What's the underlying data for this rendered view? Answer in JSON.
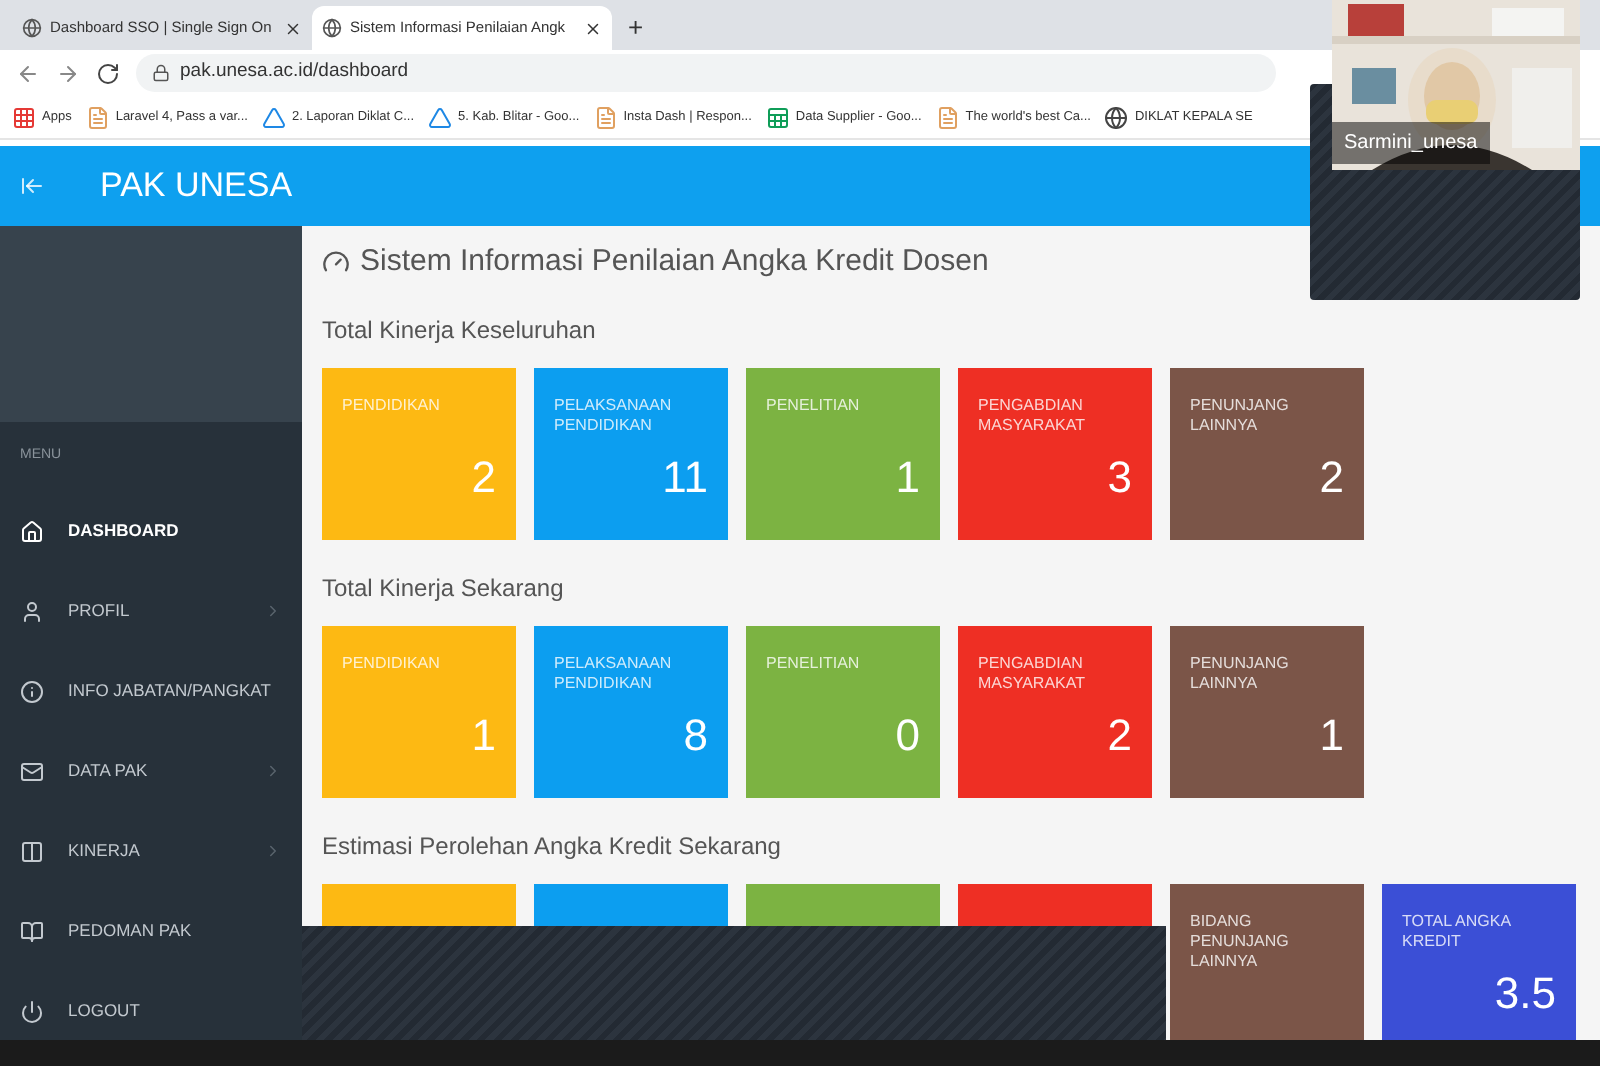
{
  "browser": {
    "tabs": [
      {
        "title": "Dashboard SSO | Single Sign On",
        "selected": false
      },
      {
        "title": "Sistem Informasi Penilaian Angk",
        "selected": true
      }
    ],
    "new_tab": "+",
    "address": "pak.unesa.ac.id/dashboard",
    "bookmarks": [
      {
        "label": "Apps",
        "kind": "apps"
      },
      {
        "label": "Laravel 4, Pass a var...",
        "kind": "page"
      },
      {
        "label": "2. Laporan Diklat C...",
        "kind": "drive"
      },
      {
        "label": "5. Kab. Blitar - Goo...",
        "kind": "drive"
      },
      {
        "label": "Insta Dash | Respon...",
        "kind": "page"
      },
      {
        "label": "Data Supplier - Goo...",
        "kind": "sheet"
      },
      {
        "label": "The world's best Ca...",
        "kind": "page"
      },
      {
        "label": "DIKLAT KEPALA SE",
        "kind": "globe"
      }
    ]
  },
  "app": {
    "title": "PAK UNESA",
    "sidebar": {
      "section": "MENU",
      "items": [
        {
          "label": "DASHBOARD",
          "selected": true,
          "has_children": false
        },
        {
          "label": "PROFIL",
          "selected": false,
          "has_children": true
        },
        {
          "label": "INFO JABATAN/PANGKAT",
          "selected": false,
          "has_children": false
        },
        {
          "label": "DATA PAK",
          "selected": false,
          "has_children": true
        },
        {
          "label": "KINERJA",
          "selected": false,
          "has_children": true
        },
        {
          "label": "PEDOMAN PAK",
          "selected": false,
          "has_children": false
        },
        {
          "label": "LOGOUT",
          "selected": false,
          "has_children": false
        }
      ]
    },
    "page_title": "Sistem Informasi Penilaian Angka Kredit Dosen",
    "sections": [
      {
        "title": "Total Kinerja Keseluruhan",
        "cards": [
          {
            "label": "PENDIDIKAN",
            "value": "2",
            "color": "#fdb913"
          },
          {
            "label": "PELAKSANAAN PENDIDIKAN",
            "value": "11",
            "color": "#0c9ef0"
          },
          {
            "label": "PENELITIAN",
            "value": "1",
            "color": "#7cb342"
          },
          {
            "label": "PENGABDIAN MASYARAKAT",
            "value": "3",
            "color": "#ee2f24"
          },
          {
            "label": "PENUNJANG LAINNYA",
            "value": "2",
            "color": "#7b5548"
          }
        ]
      },
      {
        "title": "Total Kinerja Sekarang",
        "cards": [
          {
            "label": "PENDIDIKAN",
            "value": "1",
            "color": "#fdb913"
          },
          {
            "label": "PELAKSANAAN PENDIDIKAN",
            "value": "8",
            "color": "#0c9ef0"
          },
          {
            "label": "PENELITIAN",
            "value": "0",
            "color": "#7cb342"
          },
          {
            "label": "PENGABDIAN MASYARAKAT",
            "value": "2",
            "color": "#ee2f24"
          },
          {
            "label": "PENUNJANG LAINNYA",
            "value": "1",
            "color": "#7b5548"
          }
        ]
      },
      {
        "title": "Estimasi Perolehan Angka Kredit Sekarang",
        "cards": [
          {
            "color": "#fdb913"
          },
          {
            "color": "#0c9ef0"
          },
          {
            "color": "#7cb342"
          },
          {
            "color": "#ee2f24"
          },
          {
            "label": "BIDANG PENUNJANG LAINNYA",
            "color": "#7b5548"
          },
          {
            "label": "TOTAL ANGKA KREDIT",
            "value": "3.5",
            "color": "#3b4fd6"
          }
        ]
      }
    ]
  },
  "video": {
    "name": "Sarmini_unesa"
  }
}
